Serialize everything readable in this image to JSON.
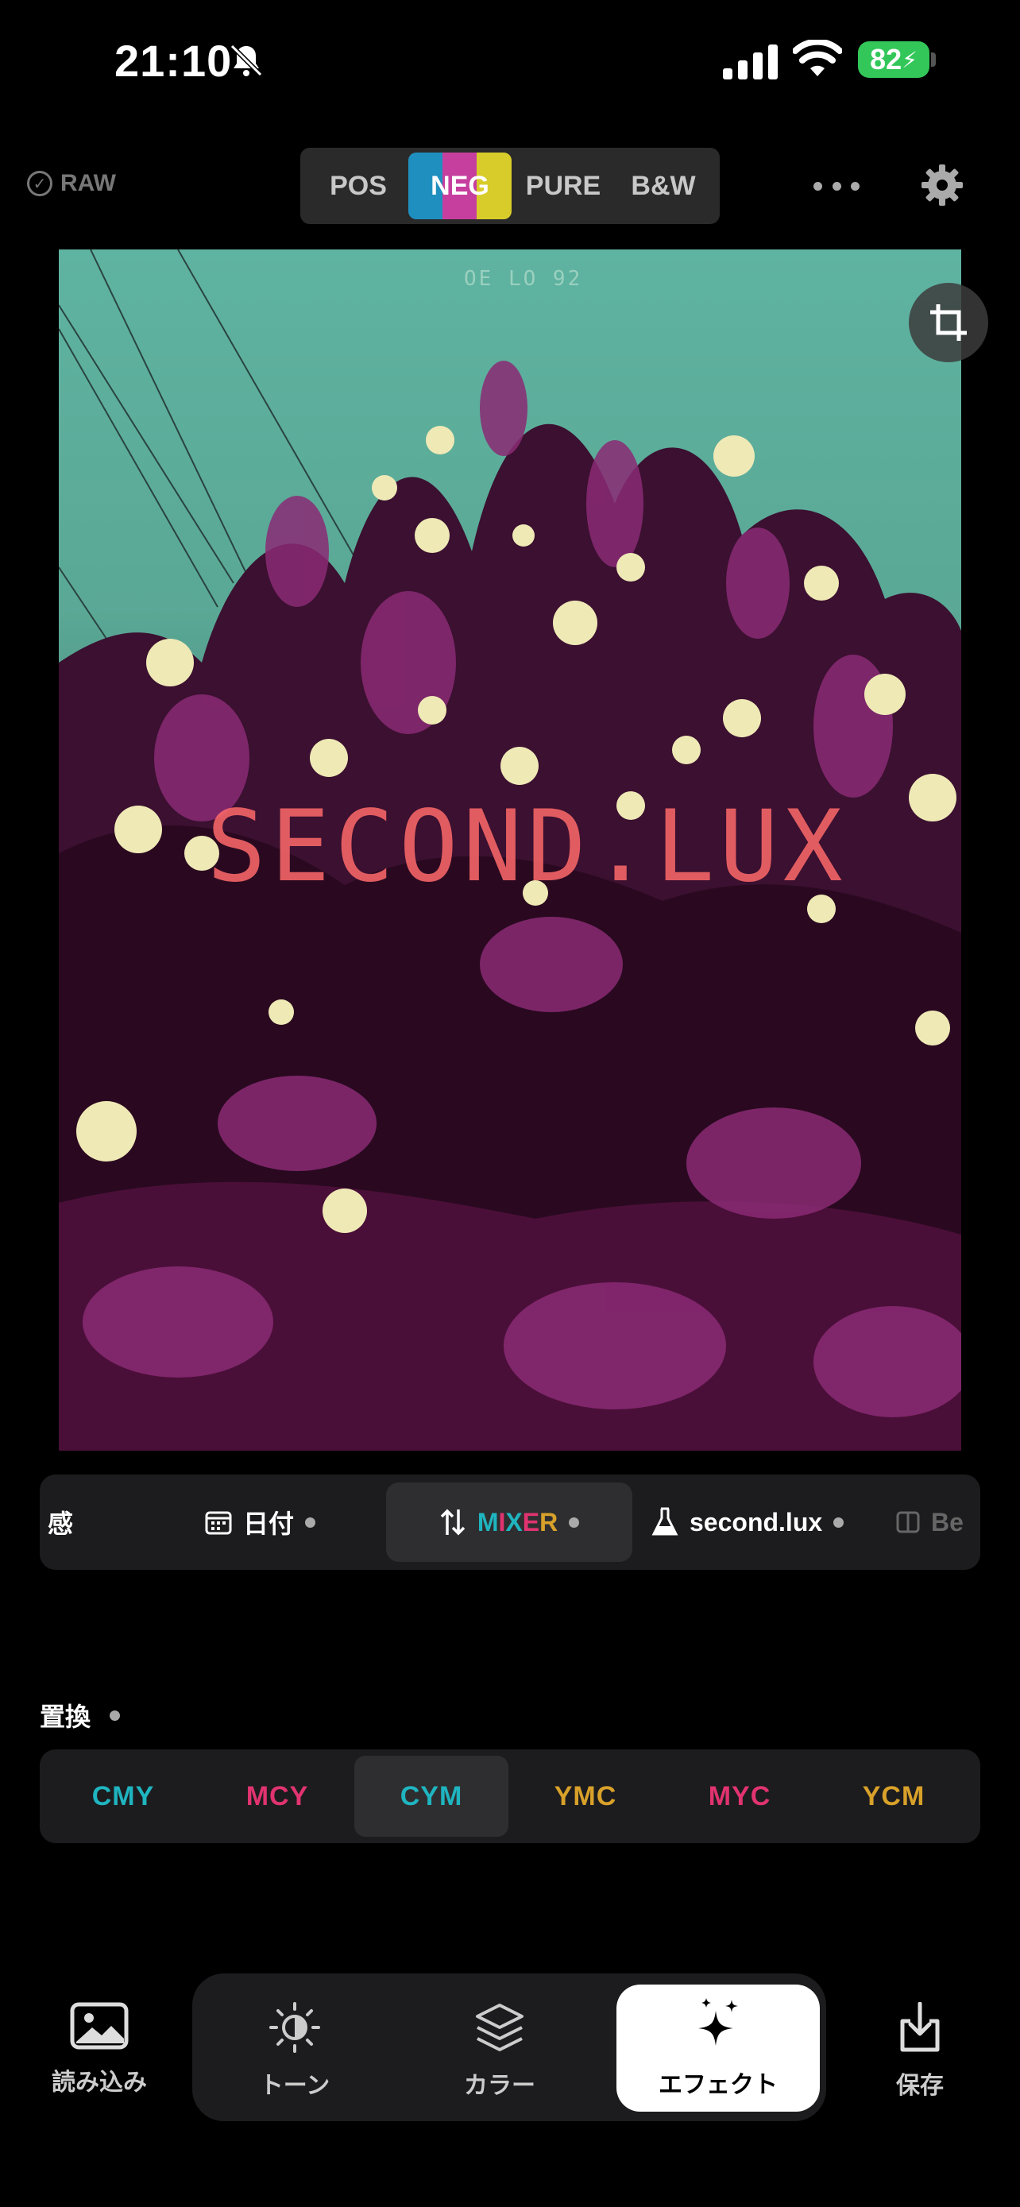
{
  "status": {
    "time": "21:10",
    "battery": "82"
  },
  "top": {
    "raw_label": "RAW",
    "modes": [
      "POS",
      "NEG",
      "PURE",
      "B&W"
    ],
    "selected_mode": "NEG"
  },
  "photo": {
    "date_stamp": "OE LO 92",
    "watermark": "SECOND.LUX"
  },
  "effect_tabs": {
    "partial_left": "感",
    "date": "日付",
    "mixer_letters": [
      "M",
      "I",
      "X",
      "E",
      "R"
    ],
    "second_lux": "second.lux",
    "partial_right": "Be"
  },
  "swap": {
    "label": "置換",
    "options": [
      "CMY",
      "MCY",
      "CYM",
      "YMC",
      "MYC",
      "YCM"
    ],
    "selected": "CYM"
  },
  "colors": {
    "cyan": "#1fb5c0",
    "magenta": "#e0336f",
    "yellow": "#d8a12a",
    "active_segment": "#2e2e30"
  },
  "toolbar": {
    "import": "読み込み",
    "tone": "トーン",
    "color": "カラー",
    "effect": "エフェクト",
    "save": "保存",
    "selected": "エフェクト"
  }
}
